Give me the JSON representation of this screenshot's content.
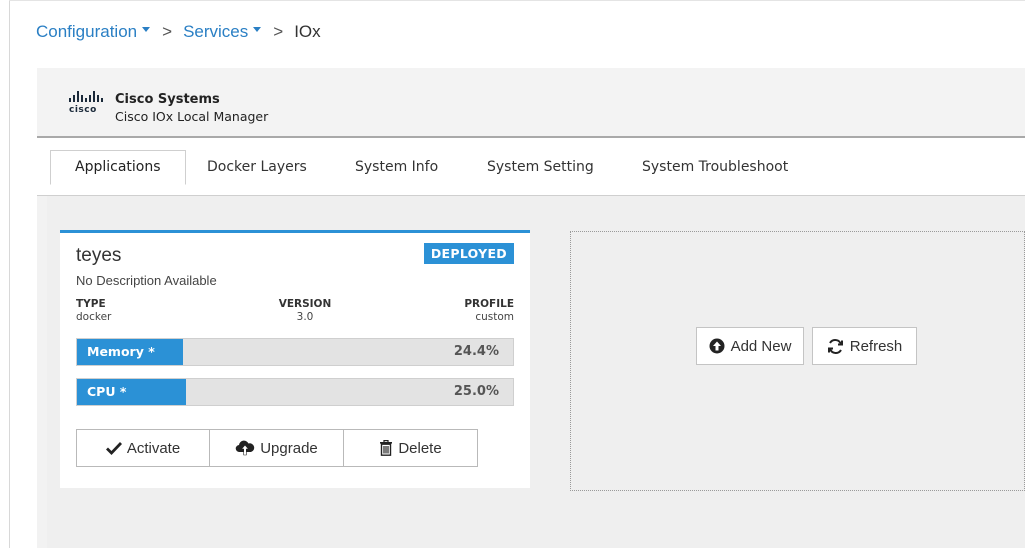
{
  "breadcrumb": {
    "items": [
      {
        "label": "Configuration",
        "dropdown": true
      },
      {
        "label": "Services",
        "dropdown": true
      }
    ],
    "separator": ">",
    "current": "IOx"
  },
  "header": {
    "logo_text": "cisco",
    "company": "Cisco Systems",
    "product": "Cisco IOx Local Manager"
  },
  "tabs": [
    {
      "label": "Applications",
      "active": true
    },
    {
      "label": "Docker Layers",
      "active": false
    },
    {
      "label": "System Info",
      "active": false
    },
    {
      "label": "System Setting",
      "active": false
    },
    {
      "label": "System Troubleshoot",
      "active": false
    }
  ],
  "app_card": {
    "name": "teyes",
    "status": "DEPLOYED",
    "description": "No Description Available",
    "type": {
      "label": "TYPE",
      "value": "docker"
    },
    "version": {
      "label": "VERSION",
      "value": "3.0"
    },
    "profile": {
      "label": "PROFILE",
      "value": "custom"
    },
    "memory": {
      "label": "Memory *",
      "value_text": "24.4%",
      "fill_percent": 24.4
    },
    "cpu": {
      "label": "CPU *",
      "value_text": "25.0%",
      "fill_percent": 25.0
    },
    "buttons": {
      "activate": "Activate",
      "upgrade": "Upgrade",
      "delete": "Delete"
    }
  },
  "actions": {
    "add_new": "Add New",
    "refresh": "Refresh"
  },
  "colors": {
    "accent": "#2b91d6",
    "link": "#2a7fc4",
    "meter_track": "#e3e3e3"
  }
}
